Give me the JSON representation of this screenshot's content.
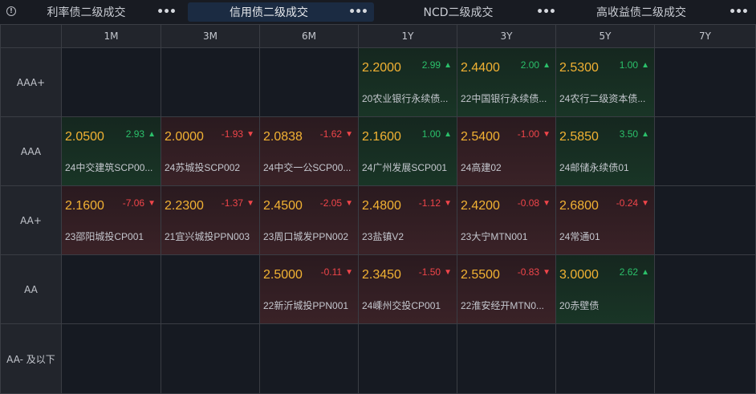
{
  "tabs": [
    {
      "label": "利率债二级成交",
      "active": false
    },
    {
      "label": "信用债二级成交",
      "active": true
    },
    {
      "label": "NCD二级成交",
      "active": false
    },
    {
      "label": "高收益债二级成交",
      "active": false
    }
  ],
  "more_glyph": "•••",
  "info_glyph": "!",
  "columns": [
    "1M",
    "3M",
    "6M",
    "1Y",
    "3Y",
    "5Y",
    "7Y"
  ],
  "rows": [
    "AAA+",
    "AAA",
    "AA+",
    "AA",
    "AA- 及以下"
  ],
  "colors": {
    "up": "#2bc06a",
    "down": "#f0454a",
    "price": "#f2b233"
  },
  "cells": [
    {
      "row": 0,
      "col": 3,
      "price": "2.2000",
      "change": "2.99",
      "dir": "up",
      "name": "20农业银行永续债..."
    },
    {
      "row": 0,
      "col": 4,
      "price": "2.4400",
      "change": "2.00",
      "dir": "up",
      "name": "22中国银行永续债..."
    },
    {
      "row": 0,
      "col": 5,
      "price": "2.5300",
      "change": "1.00",
      "dir": "up",
      "name": "24农行二级资本债..."
    },
    {
      "row": 1,
      "col": 0,
      "price": "2.0500",
      "change": "2.93",
      "dir": "up",
      "name": "24中交建筑SCP00..."
    },
    {
      "row": 1,
      "col": 1,
      "price": "2.0000",
      "change": "-1.93",
      "dir": "down",
      "name": "24苏城投SCP002"
    },
    {
      "row": 1,
      "col": 2,
      "price": "2.0838",
      "change": "-1.62",
      "dir": "down",
      "name": "24中交一公SCP00..."
    },
    {
      "row": 1,
      "col": 3,
      "price": "2.1600",
      "change": "1.00",
      "dir": "up",
      "name": "24广州发展SCP001"
    },
    {
      "row": 1,
      "col": 4,
      "price": "2.5400",
      "change": "-1.00",
      "dir": "down",
      "name": "24高建02"
    },
    {
      "row": 1,
      "col": 5,
      "price": "2.5850",
      "change": "3.50",
      "dir": "up",
      "name": "24邮储永续债01"
    },
    {
      "row": 2,
      "col": 0,
      "price": "2.1600",
      "change": "-7.06",
      "dir": "down",
      "name": "23邵阳城投CP001"
    },
    {
      "row": 2,
      "col": 1,
      "price": "2.2300",
      "change": "-1.37",
      "dir": "down",
      "name": "21宜兴城投PPN003"
    },
    {
      "row": 2,
      "col": 2,
      "price": "2.4500",
      "change": "-2.05",
      "dir": "down",
      "name": "23周口城发PPN002"
    },
    {
      "row": 2,
      "col": 3,
      "price": "2.4800",
      "change": "-1.12",
      "dir": "down",
      "name": "23盐镇V2"
    },
    {
      "row": 2,
      "col": 4,
      "price": "2.4200",
      "change": "-0.08",
      "dir": "down",
      "name": "23大宁MTN001"
    },
    {
      "row": 2,
      "col": 5,
      "price": "2.6800",
      "change": "-0.24",
      "dir": "down",
      "name": "24常通01"
    },
    {
      "row": 3,
      "col": 2,
      "price": "2.5000",
      "change": "-0.11",
      "dir": "down",
      "name": "22新沂城投PPN001"
    },
    {
      "row": 3,
      "col": 3,
      "price": "2.3450",
      "change": "-1.50",
      "dir": "down",
      "name": "24嵊州交投CP001"
    },
    {
      "row": 3,
      "col": 4,
      "price": "2.5500",
      "change": "-0.83",
      "dir": "down",
      "name": "22淮安经开MTN0..."
    },
    {
      "row": 3,
      "col": 5,
      "price": "3.0000",
      "change": "2.62",
      "dir": "up",
      "name": "20赤壁债"
    }
  ]
}
